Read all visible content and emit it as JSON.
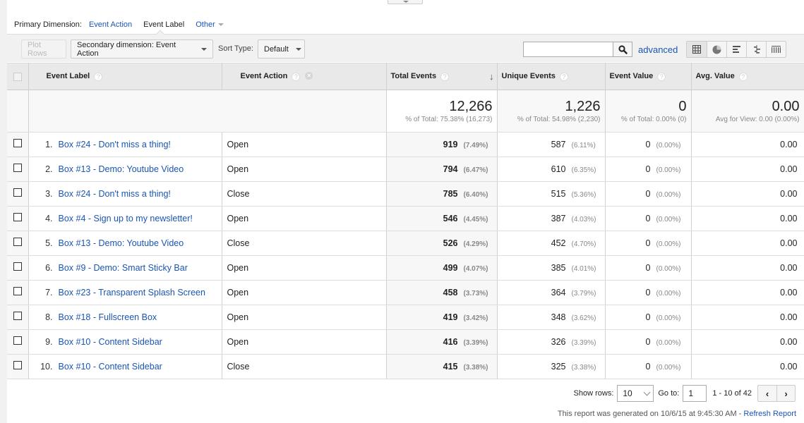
{
  "primary_dimension": {
    "label": "Primary Dimension:",
    "options": [
      {
        "label": "Event Action",
        "active": false
      },
      {
        "label": "Event Label",
        "active": true
      },
      {
        "label": "Other",
        "active": false
      }
    ]
  },
  "toolbar": {
    "plot_rows": "Plot Rows",
    "secondary_dimension": "Secondary dimension: Event Action",
    "sort_type_label": "Sort Type:",
    "sort_type_value": "Default",
    "search_value": "",
    "advanced": "advanced",
    "views": [
      "table-view-icon",
      "pie-view-icon",
      "performance-view-icon",
      "comparison-view-icon",
      "term-cloud-view-icon"
    ]
  },
  "table": {
    "headers": {
      "event_label": "Event Label",
      "event_action": "Event Action",
      "total_events": "Total Events",
      "unique_events": "Unique Events",
      "event_value": "Event Value",
      "avg_value": "Avg. Value"
    },
    "help_glyph": "?",
    "totals": {
      "total_events": "12,266",
      "total_events_sub": "% of Total: 75.38% (16,273)",
      "unique_events": "1,226",
      "unique_events_sub": "% of Total: 54.98% (2,230)",
      "event_value": "0",
      "event_value_sub": "% of Total: 0.00% (0)",
      "avg_value": "0.00",
      "avg_value_sub": "Avg for View: 0.00 (0.00%)"
    },
    "rows": [
      {
        "idx": "1.",
        "label": "Box #24 - Don't miss a thing!",
        "action": "Open",
        "total": "919",
        "total_pct": "(7.49%)",
        "unique": "587",
        "unique_pct": "(6.11%)",
        "value": "0",
        "value_pct": "(0.00%)",
        "avg": "0.00"
      },
      {
        "idx": "2.",
        "label": "Box #13 - Demo: Youtube Video",
        "action": "Open",
        "total": "794",
        "total_pct": "(6.47%)",
        "unique": "610",
        "unique_pct": "(6.35%)",
        "value": "0",
        "value_pct": "(0.00%)",
        "avg": "0.00"
      },
      {
        "idx": "3.",
        "label": "Box #24 - Don't miss a thing!",
        "action": "Close",
        "total": "785",
        "total_pct": "(6.40%)",
        "unique": "515",
        "unique_pct": "(5.36%)",
        "value": "0",
        "value_pct": "(0.00%)",
        "avg": "0.00"
      },
      {
        "idx": "4.",
        "label": "Box #4 - Sign up to my newsletter!",
        "action": "Open",
        "total": "546",
        "total_pct": "(4.45%)",
        "unique": "387",
        "unique_pct": "(4.03%)",
        "value": "0",
        "value_pct": "(0.00%)",
        "avg": "0.00"
      },
      {
        "idx": "5.",
        "label": "Box #13 - Demo: Youtube Video",
        "action": "Close",
        "total": "526",
        "total_pct": "(4.29%)",
        "unique": "452",
        "unique_pct": "(4.70%)",
        "value": "0",
        "value_pct": "(0.00%)",
        "avg": "0.00"
      },
      {
        "idx": "6.",
        "label": "Box #9 - Demo: Smart Sticky Bar",
        "action": "Open",
        "total": "499",
        "total_pct": "(4.07%)",
        "unique": "385",
        "unique_pct": "(4.01%)",
        "value": "0",
        "value_pct": "(0.00%)",
        "avg": "0.00"
      },
      {
        "idx": "7.",
        "label": "Box #23 - Transparent Splash Screen",
        "action": "Open",
        "total": "458",
        "total_pct": "(3.73%)",
        "unique": "364",
        "unique_pct": "(3.79%)",
        "value": "0",
        "value_pct": "(0.00%)",
        "avg": "0.00"
      },
      {
        "idx": "8.",
        "label": "Box #18 - Fullscreen Box",
        "action": "Open",
        "total": "419",
        "total_pct": "(3.42%)",
        "unique": "348",
        "unique_pct": "(3.62%)",
        "value": "0",
        "value_pct": "(0.00%)",
        "avg": "0.00"
      },
      {
        "idx": "9.",
        "label": "Box #10 - Content Sidebar",
        "action": "Open",
        "total": "416",
        "total_pct": "(3.39%)",
        "unique": "326",
        "unique_pct": "(3.39%)",
        "value": "0",
        "value_pct": "(0.00%)",
        "avg": "0.00"
      },
      {
        "idx": "10.",
        "label": "Box #10 - Content Sidebar",
        "action": "Close",
        "total": "415",
        "total_pct": "(3.38%)",
        "unique": "325",
        "unique_pct": "(3.38%)",
        "value": "0",
        "value_pct": "(0.00%)",
        "avg": "0.00"
      }
    ]
  },
  "pagination": {
    "show_rows_label": "Show rows:",
    "show_rows_value": "10",
    "goto_label": "Go to:",
    "goto_value": "1",
    "range": "1 - 10 of 42",
    "prev": "‹",
    "next": "›"
  },
  "footer": {
    "generated_text": "This report was generated on 10/6/15 at 9:45:30 AM - ",
    "refresh_link": "Refresh Report"
  }
}
